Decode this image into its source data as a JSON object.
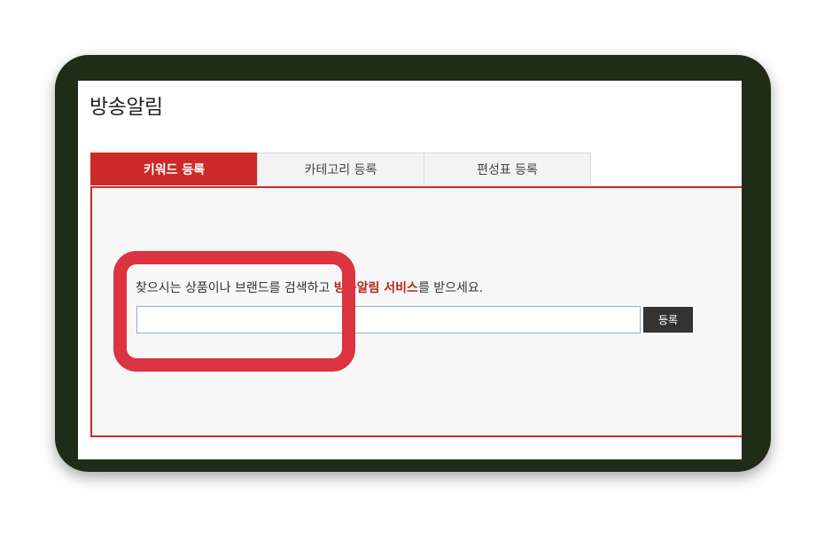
{
  "page": {
    "title": "방송알림"
  },
  "tabs": [
    {
      "label": "키워드 등록",
      "active": true
    },
    {
      "label": "카테고리 등록",
      "active": false
    },
    {
      "label": "편성표 등록",
      "active": false
    }
  ],
  "keyword": {
    "instruction_prefix": "찾으시는 상품이나 브랜드를 검색하고 ",
    "instruction_highlight": "방송알림 서비스",
    "instruction_suffix": "를 받으세요.",
    "input_value": "",
    "register_label": "등록"
  },
  "colors": {
    "accent": "#cc2a28",
    "annotation": "#dc3341",
    "frame": "#1f2c18"
  }
}
